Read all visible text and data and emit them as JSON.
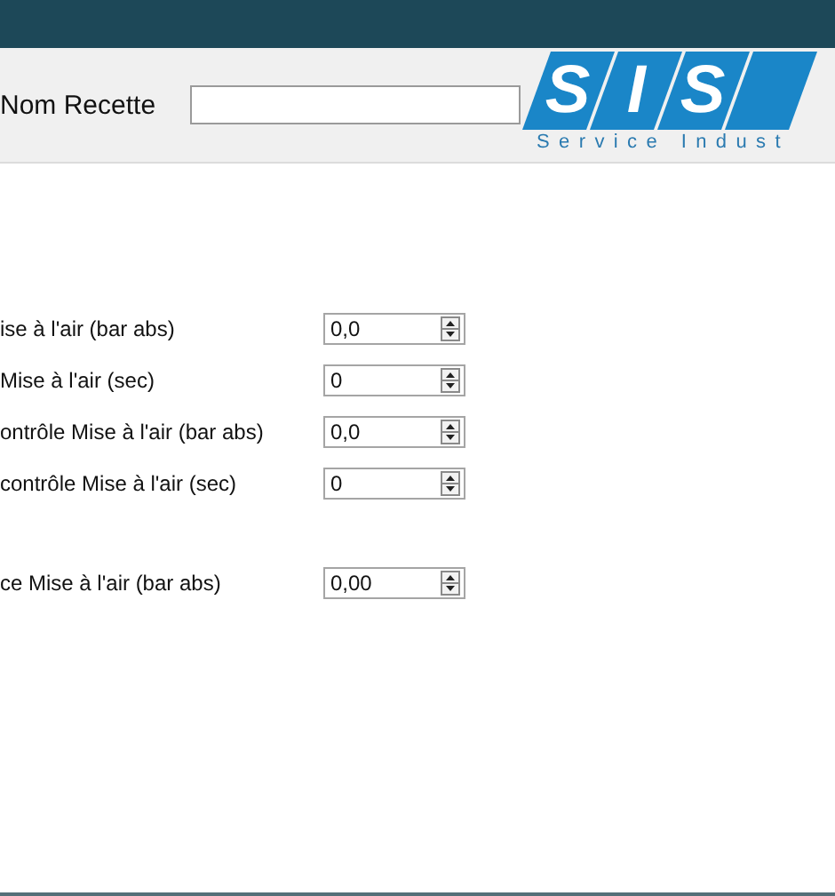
{
  "header": {
    "label": "Nom Recette"
  },
  "logo": {
    "letters": [
      "S",
      "I",
      "S"
    ],
    "tagline": "Service Indust"
  },
  "field_groups": [
    [
      {
        "label": "ise à l'air (bar abs)",
        "value": "0,0"
      },
      {
        "label": "Mise à l'air (sec)",
        "value": "0"
      },
      {
        "label": "ontrôle Mise à l'air (bar abs)",
        "value": "0,0"
      },
      {
        "label": "contrôle Mise à l'air (sec)",
        "value": "0"
      }
    ],
    [
      {
        "label": "ce Mise à l'air (bar abs)",
        "value": "0,00"
      }
    ]
  ]
}
